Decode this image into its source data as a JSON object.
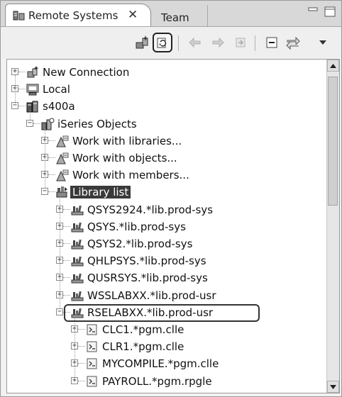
{
  "tabs": {
    "active_label": "Remote Systems",
    "close_glyph": "✕",
    "inactive_label": "Team"
  },
  "toolbar": {
    "buttons": [
      {
        "name": "new-connection-icon"
      },
      {
        "name": "refresh-icon",
        "highlighted": true
      },
      {
        "name": "back-arrow-icon"
      },
      {
        "name": "forward-arrow-icon"
      },
      {
        "name": "go-into-icon"
      },
      {
        "name": "collapse-all-icon"
      },
      {
        "name": "link-with-editor-icon"
      },
      {
        "name": "view-menu-icon"
      }
    ]
  },
  "tree": {
    "nodes": [
      {
        "label": "New Connection",
        "depth": 0,
        "expanded": false,
        "icon": "new-connection-icon"
      },
      {
        "label": "Local",
        "depth": 0,
        "expanded": false,
        "icon": "computer-icon"
      },
      {
        "label": "s400a",
        "depth": 0,
        "expanded": true,
        "icon": "system-icon"
      },
      {
        "label": "iSeries Objects",
        "depth": 1,
        "expanded": true,
        "icon": "iseries-objects-icon"
      },
      {
        "label": "Work with libraries...",
        "depth": 2,
        "expanded": false,
        "icon": "filter-icon"
      },
      {
        "label": "Work with objects...",
        "depth": 2,
        "expanded": false,
        "icon": "filter-icon"
      },
      {
        "label": "Work with members...",
        "depth": 2,
        "expanded": false,
        "icon": "filter-icon"
      },
      {
        "label": "Library list",
        "depth": 2,
        "expanded": true,
        "icon": "library-list-icon",
        "selected": true
      },
      {
        "label": "QSYS2924.*lib.prod-sys",
        "depth": 3,
        "expanded": false,
        "icon": "library-icon"
      },
      {
        "label": "QSYS.*lib.prod-sys",
        "depth": 3,
        "expanded": false,
        "icon": "library-icon"
      },
      {
        "label": "QSYS2.*lib.prod-sys",
        "depth": 3,
        "expanded": false,
        "icon": "library-icon"
      },
      {
        "label": "QHLPSYS.*lib.prod-sys",
        "depth": 3,
        "expanded": false,
        "icon": "library-icon"
      },
      {
        "label": "QUSRSYS.*lib.prod-sys",
        "depth": 3,
        "expanded": false,
        "icon": "library-icon"
      },
      {
        "label": "WSSLABXX.*lib.prod-usr",
        "depth": 3,
        "expanded": false,
        "icon": "library-icon"
      },
      {
        "label": "RSELABXX.*lib.prod-usr",
        "depth": 3,
        "expanded": true,
        "icon": "library-icon",
        "boxed": true
      },
      {
        "label": "CLC1.*pgm.clle",
        "depth": 4,
        "expanded": false,
        "icon": "program-icon"
      },
      {
        "label": "CLR1.*pgm.clle",
        "depth": 4,
        "expanded": false,
        "icon": "program-icon"
      },
      {
        "label": "MYCOMPILE.*pgm.clle",
        "depth": 4,
        "expanded": false,
        "icon": "program-icon"
      },
      {
        "label": "PAYROLL.*pgm.rpgle",
        "depth": 4,
        "expanded": false,
        "icon": "program-icon"
      }
    ]
  },
  "scrollbar": {
    "position": 0.0,
    "visible_fraction": 0.4
  }
}
